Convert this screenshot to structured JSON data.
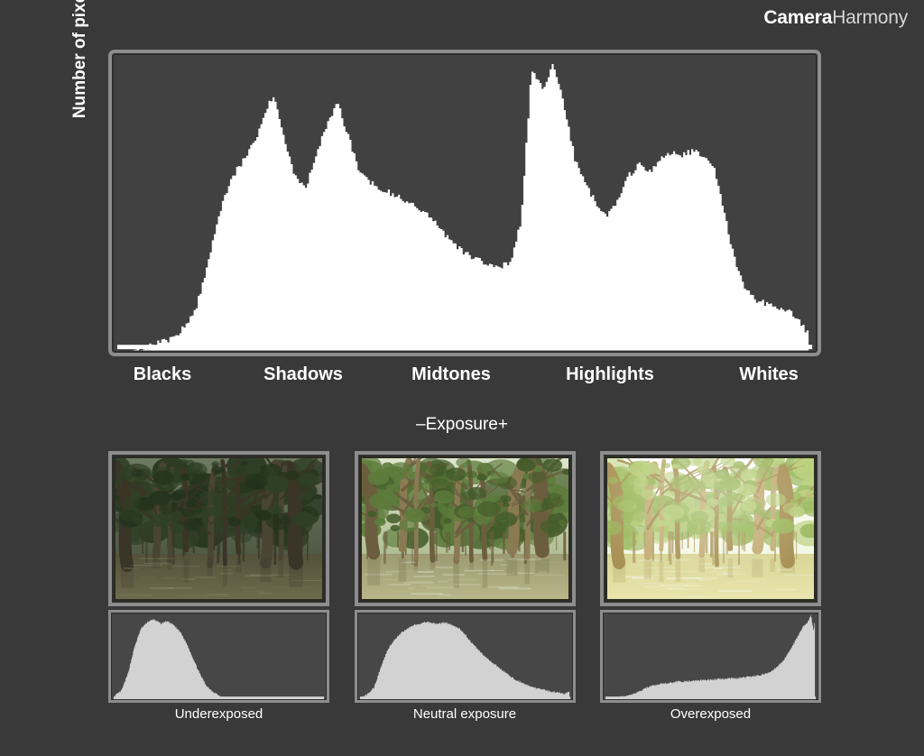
{
  "brand": {
    "bold": "Camera",
    "light": "Harmony"
  },
  "main": {
    "ylabel": "Number of pixels",
    "exposure_label": "–Exposure+",
    "xticks": [
      {
        "label": "Blacks",
        "pos": 7.5
      },
      {
        "label": "Shadows",
        "pos": 27.0
      },
      {
        "label": "Midtones",
        "pos": 47.5
      },
      {
        "label": "Highlights",
        "pos": 69.5
      },
      {
        "label": "Whites",
        "pos": 91.5
      }
    ]
  },
  "panels": [
    {
      "caption": "Underexposed",
      "key": "under"
    },
    {
      "caption": "Neutral exposure",
      "key": "neutral"
    },
    {
      "caption": "Overexposed",
      "key": "over"
    }
  ],
  "colors": {
    "page_background": "#3a3939",
    "plot_background": "#414141",
    "frame_border": "#8d8d8d",
    "frame_inner_edge": "#2e2e2e",
    "main_histogram_fill": "#ffffff",
    "mini_histogram_fill": "#d2d2d2",
    "mini_plot_background": "#474747",
    "text": "#ffffff"
  },
  "chart_data": [
    {
      "type": "area",
      "name": "main-luminance-histogram",
      "title": "",
      "xlabel": "–Exposure+",
      "ylabel": "Number of pixels",
      "grid": false,
      "legend": "none",
      "xlim": [
        0,
        255
      ],
      "ylim": [
        0,
        100
      ],
      "xtick_labels": [
        "Blacks",
        "Shadows",
        "Midtones",
        "Highlights",
        "Whites"
      ],
      "x": [
        0,
        4,
        8,
        12,
        16,
        20,
        24,
        28,
        32,
        36,
        40,
        44,
        48,
        52,
        56,
        60,
        64,
        68,
        72,
        76,
        80,
        84,
        88,
        92,
        96,
        100,
        104,
        108,
        112,
        116,
        120,
        124,
        128,
        132,
        136,
        140,
        144,
        148,
        152,
        156,
        160,
        164,
        168,
        172,
        176,
        180,
        184,
        188,
        192,
        196,
        200,
        204,
        208,
        212,
        216,
        220,
        224,
        228,
        232,
        236,
        240,
        244,
        248,
        252,
        255
      ],
      "values": [
        0,
        0,
        1,
        2,
        3,
        5,
        9,
        16,
        30,
        47,
        58,
        64,
        70,
        78,
        88,
        74,
        60,
        56,
        66,
        78,
        85,
        74,
        62,
        58,
        56,
        54,
        52,
        50,
        48,
        44,
        40,
        36,
        33,
        31,
        30,
        29,
        30,
        44,
        97,
        90,
        99,
        84,
        66,
        58,
        50,
        46,
        52,
        60,
        64,
        62,
        66,
        68,
        67,
        69,
        66,
        62,
        45,
        28,
        20,
        17,
        16,
        15,
        13,
        9,
        5
      ]
    },
    {
      "type": "area",
      "name": "underexposed-histogram",
      "grid": false,
      "legend": "none",
      "xlim": [
        0,
        255
      ],
      "ylim": [
        0,
        100
      ],
      "x": [
        0,
        8,
        16,
        24,
        32,
        40,
        48,
        56,
        64,
        72,
        80,
        88,
        96,
        104,
        112,
        120,
        128,
        136,
        144,
        152,
        160,
        168,
        176,
        184,
        192,
        200,
        208,
        216,
        224,
        232,
        240,
        248,
        255
      ],
      "values": [
        4,
        10,
        30,
        62,
        84,
        92,
        95,
        90,
        93,
        88,
        80,
        66,
        48,
        30,
        16,
        9,
        4,
        0,
        0,
        0,
        0,
        0,
        0,
        0,
        0,
        0,
        0,
        0,
        0,
        0,
        0,
        0,
        0
      ]
    },
    {
      "type": "area",
      "name": "neutral-exposure-histogram",
      "grid": false,
      "legend": "none",
      "xlim": [
        0,
        255
      ],
      "ylim": [
        0,
        100
      ],
      "x": [
        0,
        8,
        16,
        24,
        32,
        40,
        48,
        56,
        64,
        72,
        80,
        88,
        96,
        104,
        112,
        120,
        128,
        136,
        144,
        152,
        160,
        168,
        176,
        184,
        192,
        200,
        208,
        216,
        224,
        232,
        240,
        248,
        255
      ],
      "values": [
        2,
        6,
        14,
        38,
        58,
        70,
        78,
        84,
        88,
        90,
        92,
        91,
        90,
        91,
        88,
        84,
        76,
        66,
        58,
        50,
        44,
        38,
        32,
        26,
        22,
        18,
        15,
        13,
        11,
        9,
        8,
        6,
        10
      ]
    },
    {
      "type": "area",
      "name": "overexposed-histogram",
      "grid": false,
      "legend": "none",
      "xlim": [
        0,
        255
      ],
      "ylim": [
        0,
        100
      ],
      "x": [
        0,
        8,
        16,
        24,
        32,
        40,
        48,
        56,
        64,
        72,
        80,
        88,
        96,
        104,
        112,
        120,
        128,
        136,
        144,
        152,
        160,
        168,
        176,
        184,
        192,
        200,
        208,
        216,
        224,
        232,
        240,
        246,
        250,
        253,
        255
      ],
      "values": [
        1,
        2,
        3,
        4,
        6,
        9,
        13,
        16,
        18,
        19,
        20,
        21,
        21,
        22,
        22,
        23,
        23,
        24,
        24,
        25,
        25,
        26,
        27,
        28,
        30,
        33,
        38,
        46,
        58,
        72,
        86,
        92,
        100,
        80,
        98
      ]
    }
  ]
}
